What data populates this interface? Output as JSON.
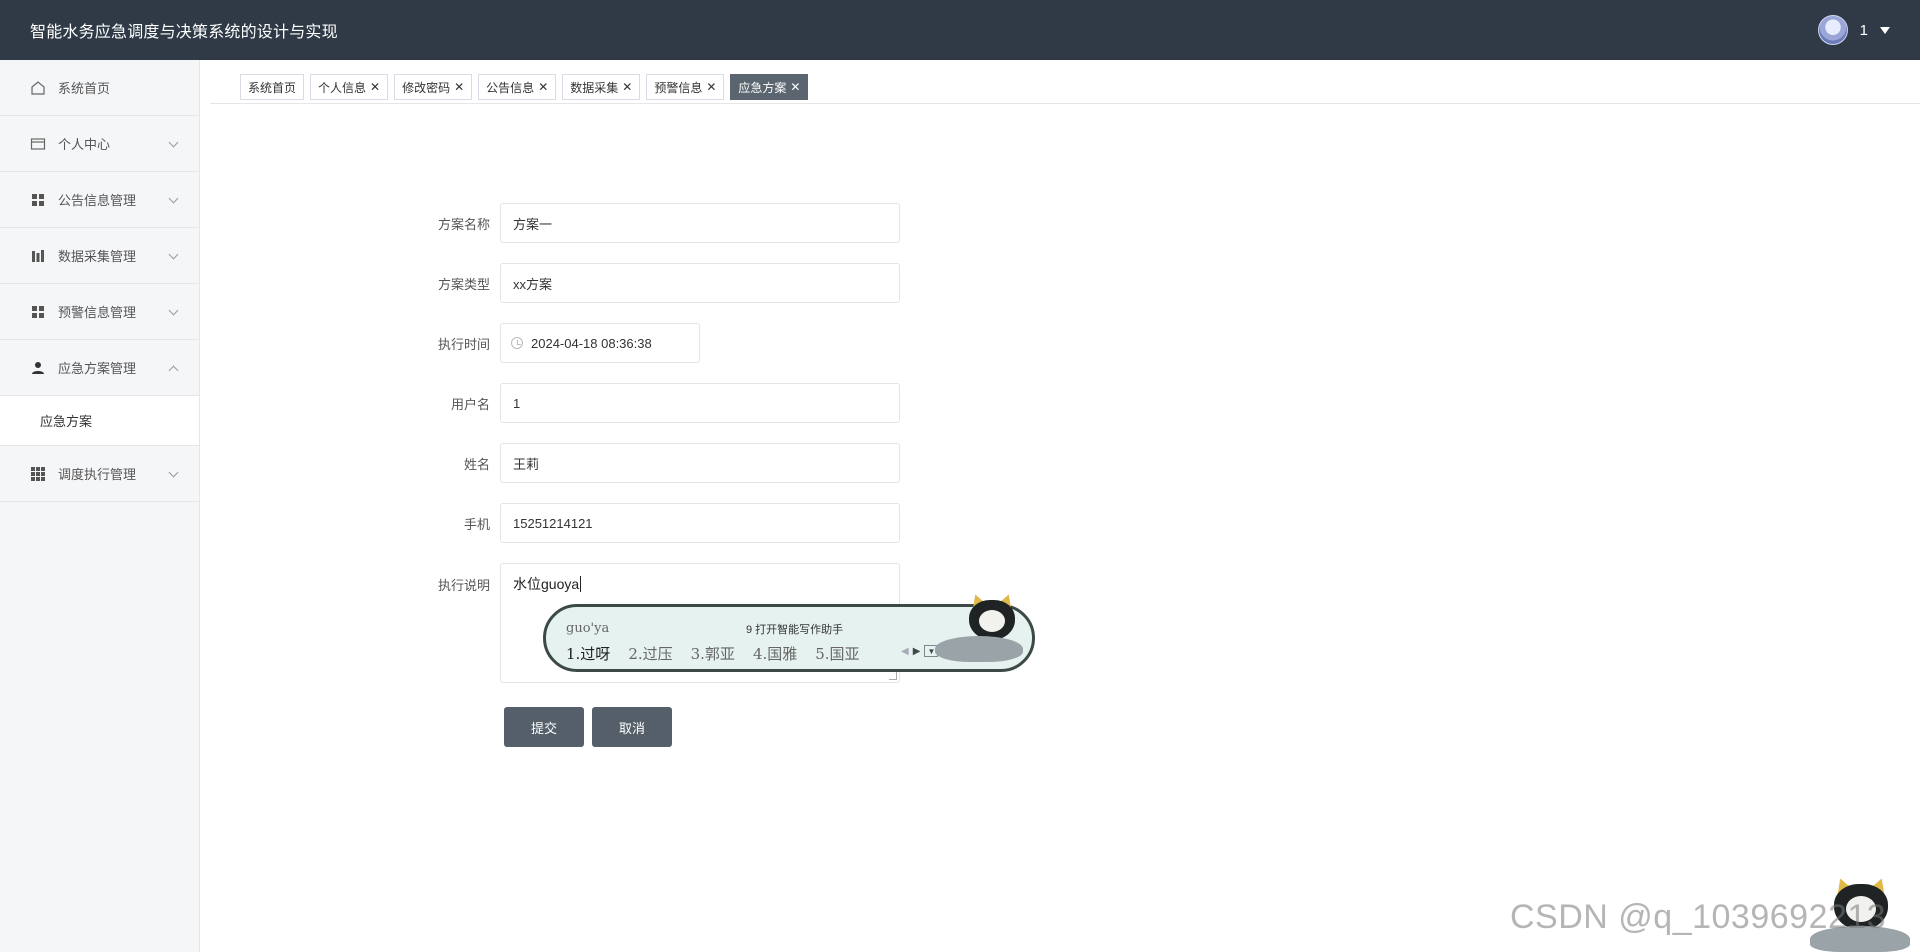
{
  "header": {
    "title": "智能水务应急调度与决策系统的设计与实现",
    "username": "1"
  },
  "sidebar": {
    "items": [
      {
        "label": "系统首页",
        "icon": "home-icon"
      },
      {
        "label": "个人中心",
        "icon": "card-icon"
      },
      {
        "label": "公告信息管理",
        "icon": "grid-icon"
      },
      {
        "label": "数据采集管理",
        "icon": "bars-icon"
      },
      {
        "label": "预警信息管理",
        "icon": "grid-icon"
      },
      {
        "label": "应急方案管理",
        "icon": "user-icon"
      },
      {
        "label": "调度执行管理",
        "icon": "apps-icon"
      }
    ],
    "subitem": "应急方案"
  },
  "tabs": [
    {
      "label": "系统首页",
      "closable": false
    },
    {
      "label": "个人信息",
      "closable": true
    },
    {
      "label": "修改密码",
      "closable": true
    },
    {
      "label": "公告信息",
      "closable": true
    },
    {
      "label": "数据采集",
      "closable": true
    },
    {
      "label": "预警信息",
      "closable": true
    },
    {
      "label": "应急方案",
      "closable": true,
      "active": true
    }
  ],
  "form": {
    "plan_name_label": "方案名称",
    "plan_name": "方案一",
    "plan_type_label": "方案类型",
    "plan_type": "xx方案",
    "exec_time_label": "执行时间",
    "exec_time": "2024-04-18 08:36:38",
    "username_label": "用户名",
    "username": "1",
    "name_label": "姓名",
    "name": "王莉",
    "phone_label": "手机",
    "phone": "15251214121",
    "desc_label": "执行说明",
    "desc": "水位guoya",
    "submit": "提交",
    "cancel": "取消"
  },
  "ime": {
    "pinyin": "guo'ya",
    "hint": "9 打开智能写作助手",
    "candidates": [
      "1.过呀",
      "2.过压",
      "3.郭亚",
      "4.国雅",
      "5.国亚"
    ]
  },
  "watermark": "CSDN @q_1039692213"
}
